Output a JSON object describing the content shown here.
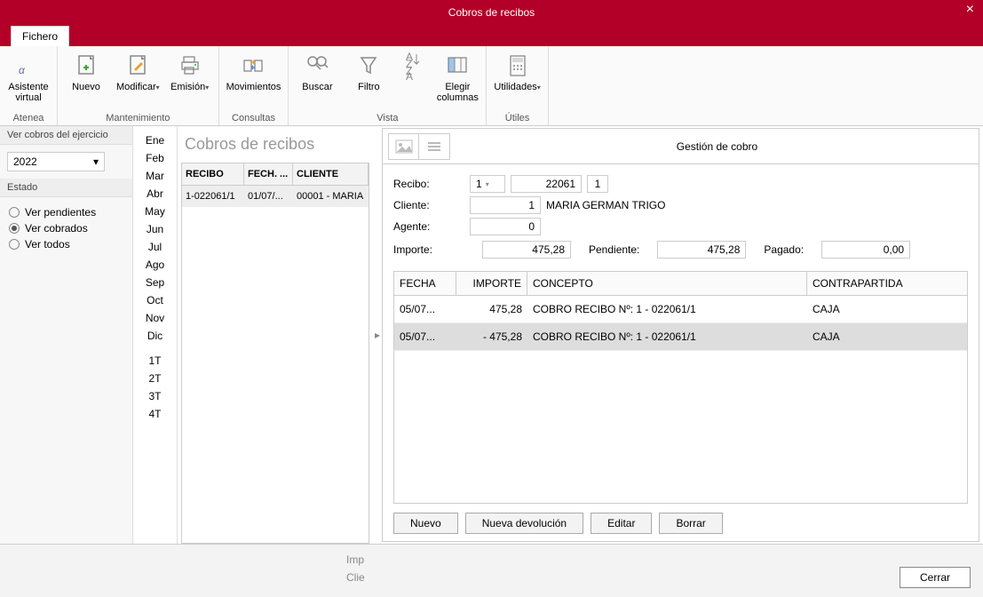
{
  "window": {
    "title": "Cobros de recibos"
  },
  "tabs": {
    "fichero": "Fichero"
  },
  "ribbon": {
    "groups": {
      "atenea": {
        "label": "Atenea",
        "asistente": "Asistente\nvirtual"
      },
      "mantenimiento": {
        "label": "Mantenimiento",
        "nuevo": "Nuevo",
        "modificar": "Modificar",
        "emision": "Emisión"
      },
      "consultas": {
        "label": "Consultas",
        "movimientos": "Movimientos"
      },
      "vista": {
        "label": "Vista",
        "buscar": "Buscar",
        "filtro": "Filtro",
        "elegir_columnas": "Elegir\ncolumnas"
      },
      "utiles": {
        "label": "Útiles",
        "utilidades": "Utilidades"
      }
    }
  },
  "leftpanel": {
    "header": "Ver cobros del ejercicio",
    "year": "2022",
    "estado_header": "Estado",
    "radios": {
      "pendientes": "Ver pendientes",
      "cobrados": "Ver cobrados",
      "todos": "Ver todos"
    }
  },
  "months": [
    "Ene",
    "Feb",
    "Mar",
    "Abr",
    "May",
    "Jun",
    "Jul",
    "Ago",
    "Sep",
    "Oct",
    "Nov",
    "Dic"
  ],
  "quarters": [
    "1T",
    "2T",
    "3T",
    "4T"
  ],
  "midlist": {
    "title": "Cobros de recibos",
    "cols": {
      "recibo": "RECIBO",
      "fecha": "FECH. ...",
      "cliente": "CLIENTE"
    },
    "row": {
      "recibo": "1-022061/1",
      "fecha": "01/07/...",
      "cliente": "00001 - MARIA"
    }
  },
  "detail": {
    "title": "Gestión de cobro",
    "labels": {
      "recibo": "Recibo:",
      "cliente": "Cliente:",
      "agente": "Agente:",
      "importe": "Importe:",
      "pendiente": "Pendiente:",
      "pagado": "Pagado:"
    },
    "recibo": {
      "serie": "1",
      "num": "22061",
      "sub": "1"
    },
    "cliente": {
      "code": "1",
      "name": "MARIA GERMAN TRIGO"
    },
    "agente": "0",
    "importe": "475,28",
    "pendiente": "475,28",
    "pagado": "0,00",
    "table": {
      "cols": {
        "fecha": "FECHA",
        "importe": "IMPORTE",
        "concepto": "CONCEPTO",
        "contrapartida": "CONTRAPARTIDA"
      },
      "rows": [
        {
          "fecha": "05/07...",
          "importe": "475,28",
          "concepto": "COBRO RECIBO Nº: 1 - 022061/1",
          "contrapartida": "CAJA"
        },
        {
          "fecha": "05/07...",
          "importe": "- 475,28",
          "concepto": "COBRO RECIBO Nº: 1 - 022061/1",
          "contrapartida": "CAJA"
        }
      ]
    },
    "buttons": {
      "nuevo": "Nuevo",
      "devolucion": "Nueva devolución",
      "editar": "Editar",
      "borrar": "Borrar"
    }
  },
  "footer": {
    "imp": "Imp",
    "clie": "Clie",
    "cerrar": "Cerrar"
  }
}
